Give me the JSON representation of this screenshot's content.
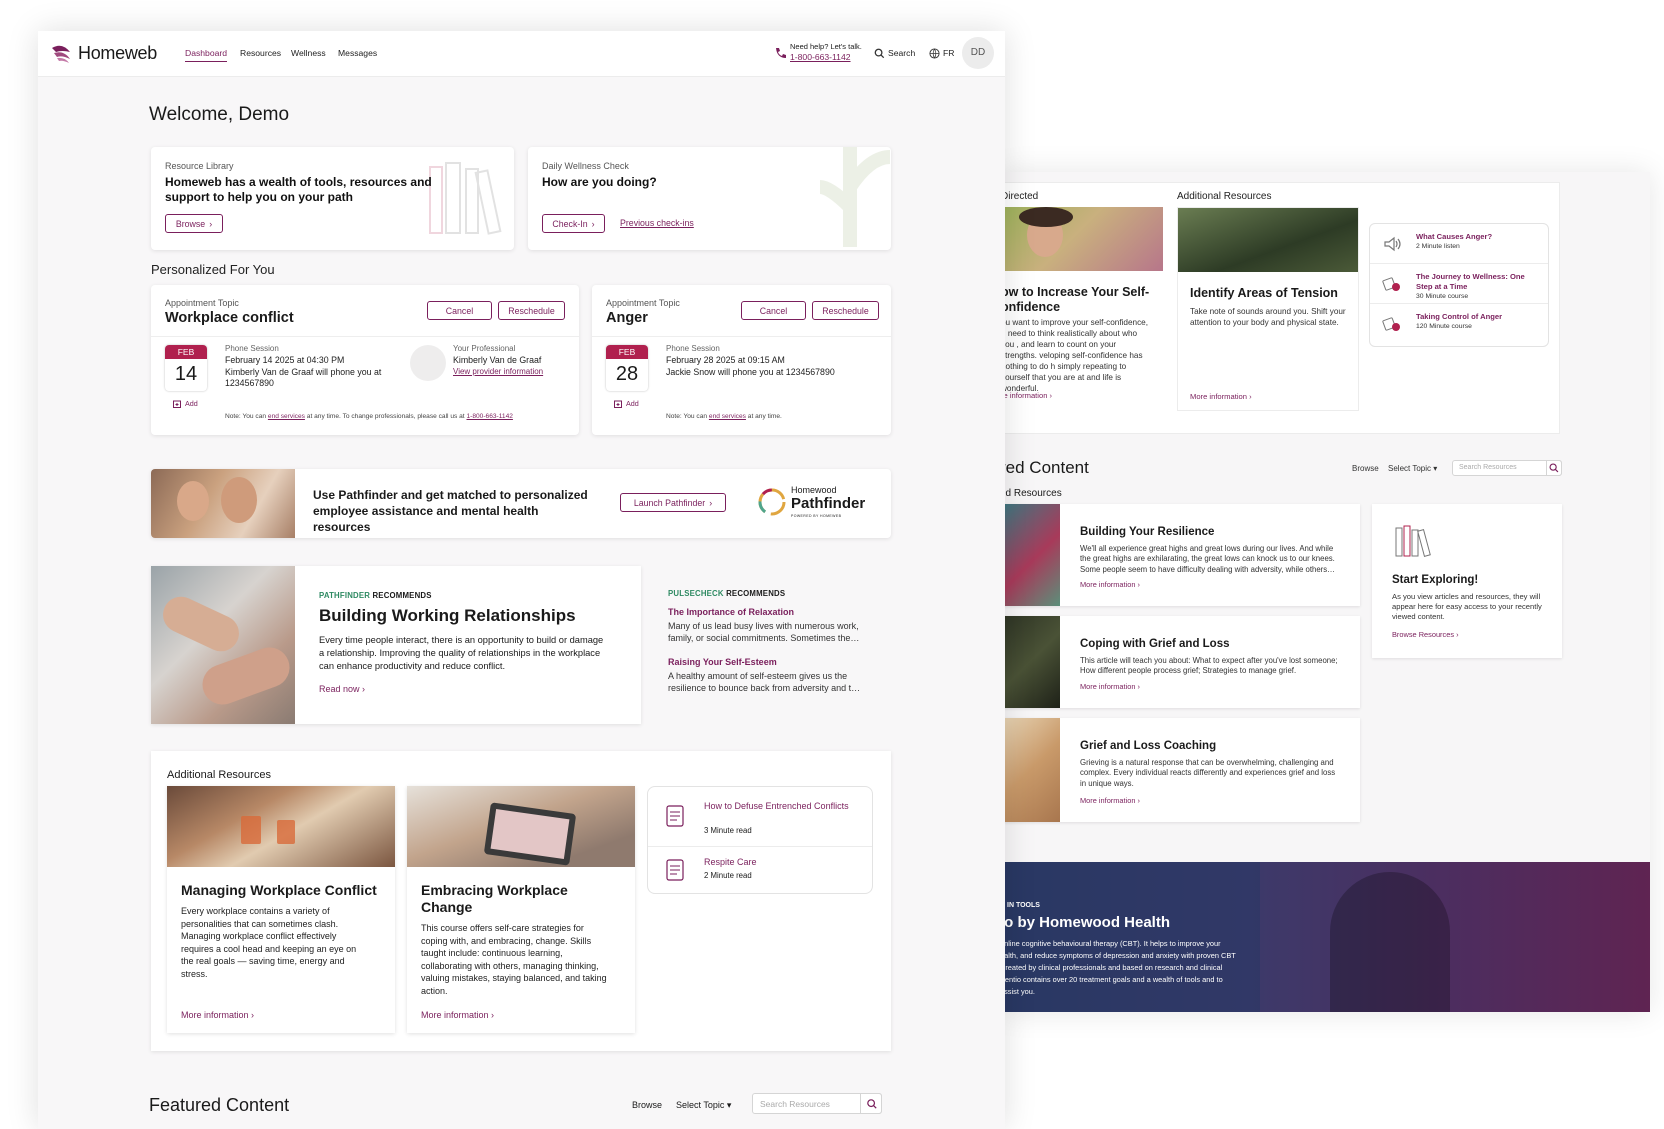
{
  "app": {
    "brand": "Homeweb",
    "accent": "#7a1f5c"
  },
  "nav": {
    "items": [
      "Dashboard",
      "Resources",
      "Wellness",
      "Messages"
    ],
    "active": "Dashboard",
    "help_label": "Need help? Let's talk.",
    "help_phone": "1-800-663-1142",
    "search_label": "Search",
    "lang_label": "FR",
    "avatar_initials": "DD"
  },
  "welcome": "Welcome, Demo",
  "resource_library": {
    "kicker": "Resource Library",
    "title": "Homeweb has a wealth of tools, resources and support to help you on your path",
    "button": "Browse"
  },
  "wellness_check": {
    "kicker": "Daily Wellness Check",
    "title": "How are you doing?",
    "button": "Check-In",
    "link": "Previous check-ins"
  },
  "personalized": {
    "heading": "Personalized For You",
    "appointments": [
      {
        "kicker": "Appointment Topic",
        "topic": "Workplace conflict",
        "cancel": "Cancel",
        "reschedule": "Reschedule",
        "month": "FEB",
        "day": "14",
        "add": "Add",
        "session_type": "Phone Session",
        "when": "February 14 2025 at 04:30 PM",
        "detail": "Kimberly Van de Graaf will phone you at 1234567890",
        "pro_label": "Your Professional",
        "pro_name": "Kimberly Van de Graaf",
        "pro_link": "View provider information",
        "note_a": "Note: You can",
        "note_link": "end services",
        "note_b": "at any time. To change professionals, please call us at",
        "note_phone": "1-800-663-1142"
      },
      {
        "kicker": "Appointment Topic",
        "topic": "Anger",
        "cancel": "Cancel",
        "reschedule": "Reschedule",
        "month": "FEB",
        "day": "28",
        "add": "Add",
        "session_type": "Phone Session",
        "when": "February 28 2025 at 09:15 AM",
        "detail": "Jackie Snow will phone you at 1234567890",
        "note_a": "Note: You can",
        "note_link": "end services",
        "note_b": "at any time."
      }
    ]
  },
  "pathfinder": {
    "text": "Use Pathfinder and get matched to personalized employee assistance and mental health resources",
    "button": "Launch Pathfinder",
    "logo_top": "Homewood",
    "logo_main": "Pathfinder",
    "logo_sub": "POWERED BY HOMEWEB"
  },
  "pathfinder_rec": {
    "brand": "PATHFINDER",
    "suffix": "RECOMMENDS",
    "title": "Building Working Relationships",
    "text": "Every time people interact, there is an opportunity to build or damage a relationship. Improving the quality of relationships in the workplace can enhance productivity and reduce conflict.",
    "link": "Read now"
  },
  "pulsecheck": {
    "brand": "PULSECHECK",
    "suffix": "RECOMMENDS",
    "items": [
      {
        "title": "The Importance of Relaxation",
        "text": "Many of us lead busy lives with numerous work, family, or social commitments. Sometimes the…"
      },
      {
        "title": "Raising Your Self-Esteem",
        "text": "A healthy amount of self-esteem gives us the resilience to bounce back from adversity and t…"
      }
    ]
  },
  "additional": {
    "heading": "Additional Resources",
    "cards": [
      {
        "title": "Managing Workplace Conflict",
        "text": "Every workplace contains a variety of personalities that can sometimes clash. Managing workplace conflict effectively requires a cool head and keeping an eye on the real goals — saving time, energy and stress.",
        "link": "More information"
      },
      {
        "title": "Embracing Workplace Change",
        "text": "This course offers self-care strategies for coping with, and embracing, change. Skills taught include: continuous learning, collaborating with others, managing thinking, valuing mistakes, staying balanced, and taking action.",
        "link": "More information"
      }
    ],
    "list": [
      {
        "title": "How to Defuse Entrenched Conflicts",
        "meta": "3 Minute read"
      },
      {
        "title": "Respite Care",
        "meta": "2 Minute read"
      }
    ]
  },
  "featured": {
    "heading": "Featured Content",
    "browse": "Browse",
    "select": "Select Topic",
    "placeholder": "Search Resources"
  },
  "back": {
    "directed_label": "Directed",
    "additional_label": "Additional Resources",
    "card1": {
      "title": "ow to Increase Your Self-\nonfidence",
      "text": "ou want to improve your self-confidence, u need to think realistically about who you , and learn to count on your strengths. veloping self-confidence has nothing to do h simply repeating to yourself that you are at and life is wonderful.",
      "link": "re information"
    },
    "card2": {
      "title": "Identify Areas of Tension",
      "text": "Take note of sounds around you. Shift your attention to your body and physical state.",
      "link": "More information"
    },
    "list": [
      {
        "title": "What Causes Anger?",
        "meta": "2 Minute listen"
      },
      {
        "title": "The Journey to Wellness: One Step at a Time",
        "meta": "30 Minute course"
      },
      {
        "title": "Taking Control of Anger",
        "meta": "120 Minute course"
      }
    ],
    "featured_heading": "red Content",
    "featured_sub": "ed Resources",
    "browse": "Browse",
    "select": "Select Topic",
    "placeholder": "Search Resources",
    "rows": [
      {
        "title": "Building Your Resilience",
        "text": "We'll all experience great highs and great lows during our lives. And while the great highs are exhilarating, the great lows can knock us to our knees. Some people seem to have difficulty dealing with adversity, while others…",
        "link": "More information"
      },
      {
        "title": "Coping with Grief and Loss",
        "text": "This article will teach you about: What to expect after you've lost someone; How different people process grief; Strategies to manage grief.",
        "link": "More information"
      },
      {
        "title": "Grief and Loss Coaching",
        "text": "Grieving is a natural response that can be overwhelming, challenging and complex. Every individual reacts differently and experiences grief and loss in unique ways.",
        "link": "More information"
      }
    ],
    "explore": {
      "title": "Start Exploring!",
      "text": "As you view articles and resources, they will appear here for easy access to your recently viewed content.",
      "link": "Browse Resources"
    },
    "banner": {
      "kicker": "D IN TOOLS",
      "title": "io by Homewood Health",
      "text": "online cognitive behavioural therapy (CBT). It helps to improve your ealth, and reduce symptoms of depression and anxiety with proven CBT Created by clinical professionals and based on research and clinical Sentio contains over 20 treatment goals and a wealth of tools and to assist you."
    }
  }
}
